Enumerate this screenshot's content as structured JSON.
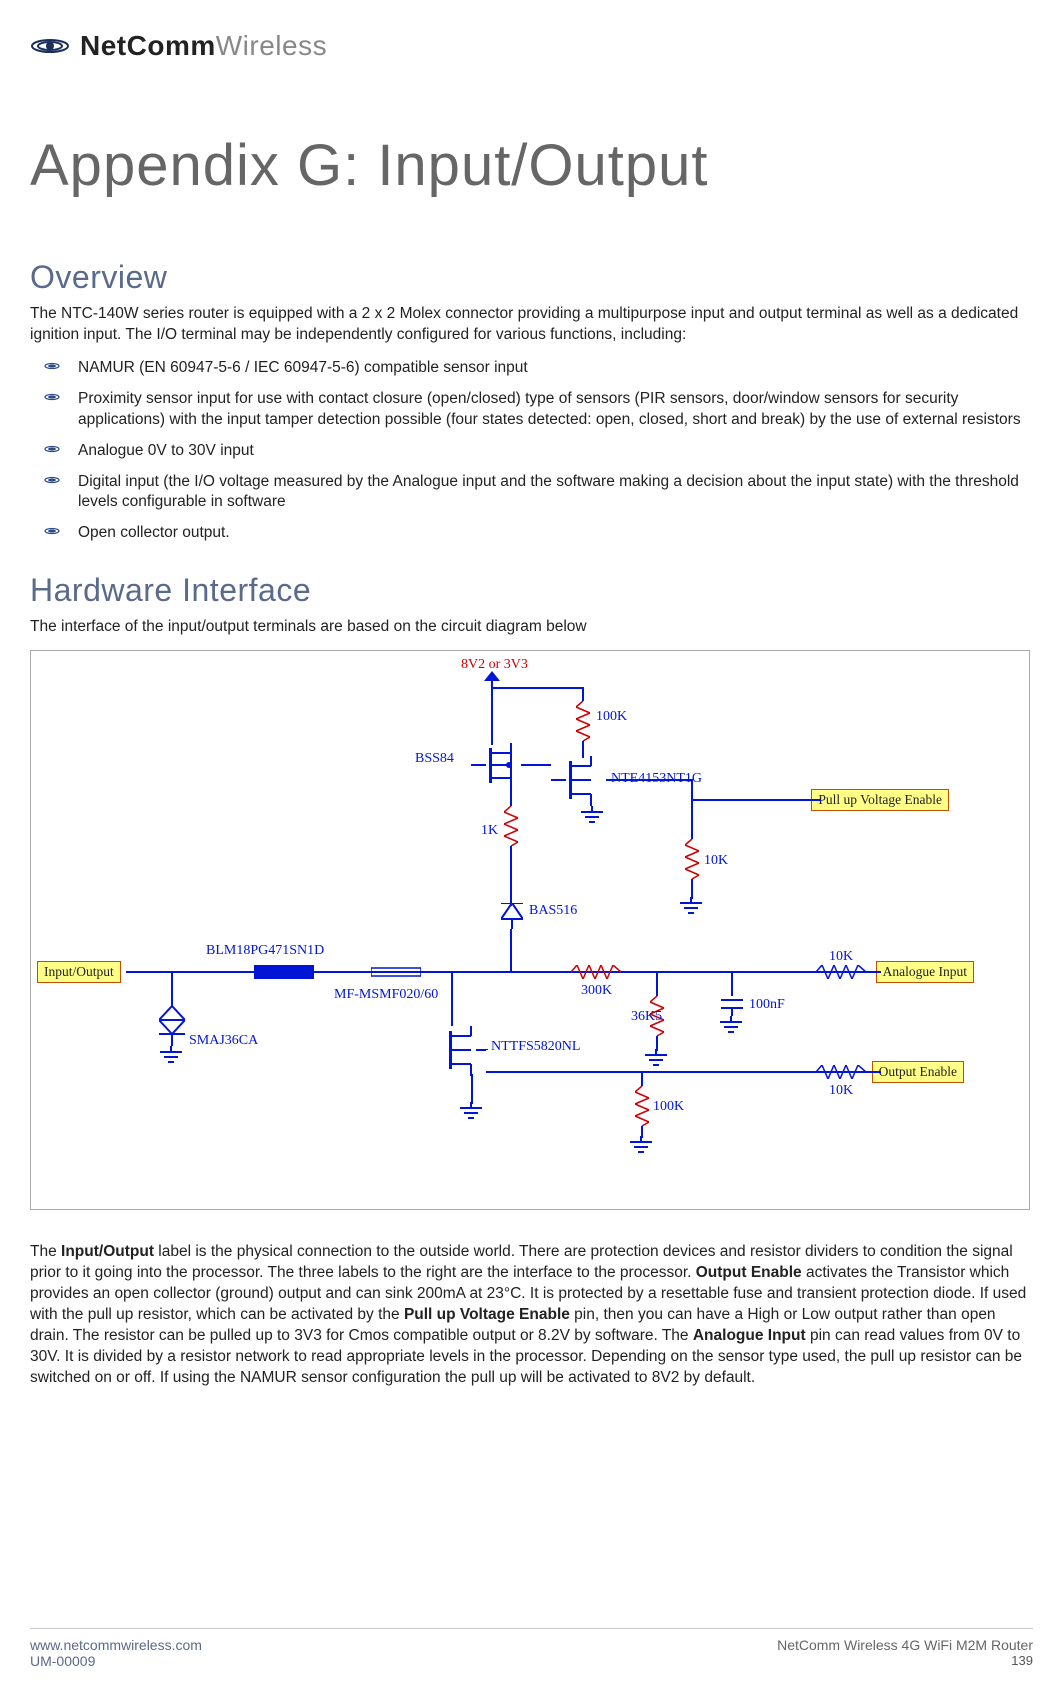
{
  "brand": {
    "bold": "NetComm",
    "light": "Wireless"
  },
  "title": "Appendix G: Input/Output",
  "overview": {
    "heading": "Overview",
    "intro": "The NTC-140W series router is equipped with a 2 x 2 Molex connector providing a multipurpose input and output terminal as well as a dedicated ignition input. The I/O terminal may be independently configured for various functions, including:",
    "items": [
      "NAMUR (EN 60947-5-6 / IEC 60947-5-6) compatible sensor input",
      "Proximity sensor input for use with contact closure (open/closed) type of sensors (PIR sensors, door/window sensors for security applications) with the input tamper detection possible (four states detected: open, closed, short and break) by the use of external resistors",
      "Analogue 0V to 30V input",
      "Digital input (the I/O voltage measured by the Analogue input and the software making a decision about the input state) with the threshold levels configurable in software",
      "Open collector output."
    ]
  },
  "hardware": {
    "heading": "Hardware Interface",
    "intro": "The interface of the input/output terminals are based on the circuit diagram below",
    "labels": {
      "vtop": "8V2 or 3V3",
      "r100k_a": "100K",
      "bss84": "BSS84",
      "nte": "NTE4153NT1G",
      "r1k": "1K",
      "r10k_a": "10K",
      "bas516": "BAS516",
      "blm": "BLM18PG471SN1D",
      "mf": "MF-MSMF020/60",
      "r300k": "300K",
      "r36k5": "36K5",
      "c100n": "100nF",
      "r10k_b": "10K",
      "smaj": "SMAJ36CA",
      "nttfs": "NTTFS5820NL",
      "r100k_b": "100K",
      "r10k_c": "10K"
    },
    "pins": {
      "io": "Input/Output",
      "pullup": "Pull up Voltage Enable",
      "ain": "Analogue Input",
      "oen": "Output Enable"
    },
    "explain_parts": {
      "p1": "The ",
      "b1": "Input/Output",
      "p2": " label is the physical connection to the outside world. There are protection devices and resistor dividers to condition the signal prior to it going into the processor. The three labels to the right are the interface to the processor. ",
      "b2": "Output Enable",
      "p3": " activates the Transistor which provides an open collector (ground) output and can sink 200mA at 23°C. It is protected by a resettable fuse and transient protection diode. If used with the pull up resistor, which can be activated by the ",
      "b3": "Pull up Voltage Enable",
      "p4": " pin, then you can have a High or Low output rather than open drain. The resistor can be pulled up to 3V3 for Cmos compatible output or 8.2V by software. The ",
      "b4": "Analogue Input",
      "p5": " pin can read values from 0V to 30V. It is divided by a resistor network to read appropriate levels in the processor. Depending on the sensor type used, the pull up resistor can be switched on or off. If using the NAMUR sensor configuration the pull up will be activated to 8V2 by default."
    }
  },
  "footer": {
    "url": "www.netcommwireless.com",
    "doc": "UM-00009",
    "product": "NetComm Wireless 4G WiFi M2M Router",
    "page": "139"
  }
}
